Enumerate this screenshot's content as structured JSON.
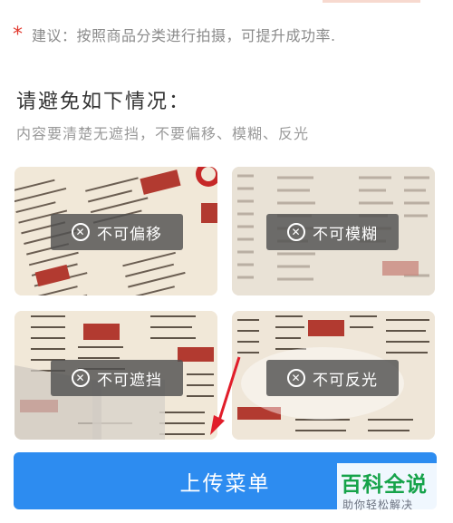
{
  "tip": {
    "marker": "*",
    "text": "建议：按照商品分类进行拍摄，可提升成功率."
  },
  "avoid_section": {
    "title": "请避免如下情况：",
    "subtitle": "内容要清楚无遮挡，不要偏移、模糊、反光"
  },
  "examples": [
    {
      "label": "不可偏移",
      "icon": "close-circle-icon"
    },
    {
      "label": "不可模糊",
      "icon": "close-circle-icon"
    },
    {
      "label": "不可遮挡",
      "icon": "close-circle-icon"
    },
    {
      "label": "不可反光",
      "icon": "close-circle-icon"
    }
  ],
  "upload_button": {
    "label": "上传菜单"
  },
  "watermark": {
    "title": "百科全说",
    "subtitle": "助你轻松解决"
  },
  "colors": {
    "accent_blue": "#2d8cf0",
    "warning_red": "#e23a2f",
    "watermark_green": "#16a34a"
  }
}
